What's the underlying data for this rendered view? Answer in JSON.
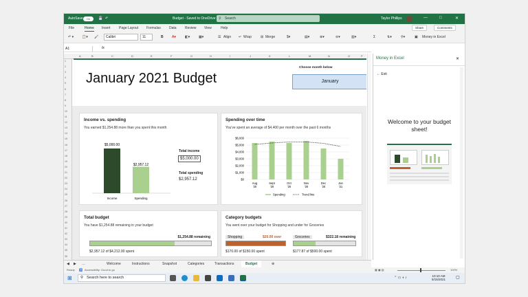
{
  "titlebar": {
    "autosave": "AutoSave",
    "toggle": "On",
    "doc_title": "Budget - Saved to OneDrive",
    "search_placeholder": "Search",
    "user": "Taylor Phillips",
    "minimize": "—",
    "maximize": "□",
    "close": "✕"
  },
  "menu_tabs": [
    "File",
    "Home",
    "Insert",
    "Page Layout",
    "Formulas",
    "Data",
    "Review",
    "View",
    "Help"
  ],
  "share": "Share",
  "comments": "Comments",
  "ribbon": {
    "font": "Calibri",
    "size": "11",
    "bold": "B",
    "align": "Align",
    "wrap": "Wrap",
    "merge": "Merge",
    "sum": "Σ",
    "money_btn": "Money in Excel"
  },
  "formula": {
    "cell": "A1",
    "fx": "fx"
  },
  "columns": [
    "A",
    "B",
    "C",
    "D",
    "E",
    "F",
    "G",
    "H",
    "I",
    "J",
    "K",
    "L",
    "M",
    "N",
    "O",
    "P"
  ],
  "page_title": "January 2021 Budget",
  "choose_label": "Choose month below",
  "selected_month": "January",
  "income_card": {
    "title": "Income vs. spending",
    "subtitle": "You earned $1,254.88 more than you spent this month",
    "total_income_label": "Total income",
    "total_income": "$5,000.00",
    "total_spending_label": "Total spending",
    "total_spending": "$2,957.12"
  },
  "spending_card": {
    "title": "Spending over time",
    "subtitle": "You've spent an average of $4,400 per month over the past 6 months",
    "legend_spending": "Spending",
    "legend_trend": "Trend line"
  },
  "total_budget": {
    "title": "Total budget",
    "subtitle": "You have $1,254.88 remaining in your budget",
    "remaining": "$1,254.88 remaining",
    "spent": "$2,957.12 of $4,212.00 spent",
    "fill": 0.7
  },
  "category": {
    "title": "Category budgets",
    "subtitle": "You went over your budget for Shopping and under for Groceries",
    "shopping_label": "Shopping",
    "shopping_status": "$20.00 over",
    "shopping_spent": "$170.00 of $150.00 spent",
    "shopping_fill": 1.0,
    "groceries_label": "Groceries",
    "groceries_status": "$322.18 remaining",
    "groceries_spent": "$177.87 of $500.00 spent",
    "groceries_fill": 0.36
  },
  "sheet_tabs": [
    "Welcome",
    "Instructions",
    "Snapshot",
    "Categories",
    "Transactions",
    "Budget"
  ],
  "status": {
    "ready": "Ready",
    "accessibility": "Accessibility: Good to go",
    "zoom": "100%"
  },
  "pane": {
    "title": "Money in Excel",
    "exit": "Exit",
    "welcome": "Welcome to your budget sheet!",
    "close": "✕"
  },
  "taskbar": {
    "search": "Search here to search",
    "time": "10:10 AM",
    "date": "5/15/2021"
  },
  "colors": {
    "excel_green": "#217346",
    "dark_bar": "#2d4a2b",
    "light_bar": "#a9d08e",
    "over": "#c0602a"
  },
  "chart_data": [
    {
      "type": "bar",
      "title": "Income vs. spending",
      "categories": [
        "Income",
        "Spending"
      ],
      "values": [
        5000,
        2957.12
      ],
      "data_labels": [
        "$5,000.00",
        "$2,957.12"
      ]
    },
    {
      "type": "bar",
      "title": "Spending over time",
      "categories": [
        "Aug '20",
        "Sept '20",
        "Oct '20",
        "Nov '20",
        "Dec '20",
        "Jan '21"
      ],
      "series": [
        {
          "name": "Spending",
          "values": [
            5300,
            5500,
            5300,
            5600,
            4500,
            3000
          ]
        },
        {
          "name": "Trend line",
          "values": [
            5100,
            5300,
            5450,
            5450,
            5250,
            4800
          ]
        }
      ],
      "yticks": [
        "$0",
        "$1,000",
        "$2,000",
        "$3,000",
        "$4,000",
        "$5,000",
        "$6,000"
      ],
      "ylim": [
        0,
        6000
      ]
    }
  ]
}
